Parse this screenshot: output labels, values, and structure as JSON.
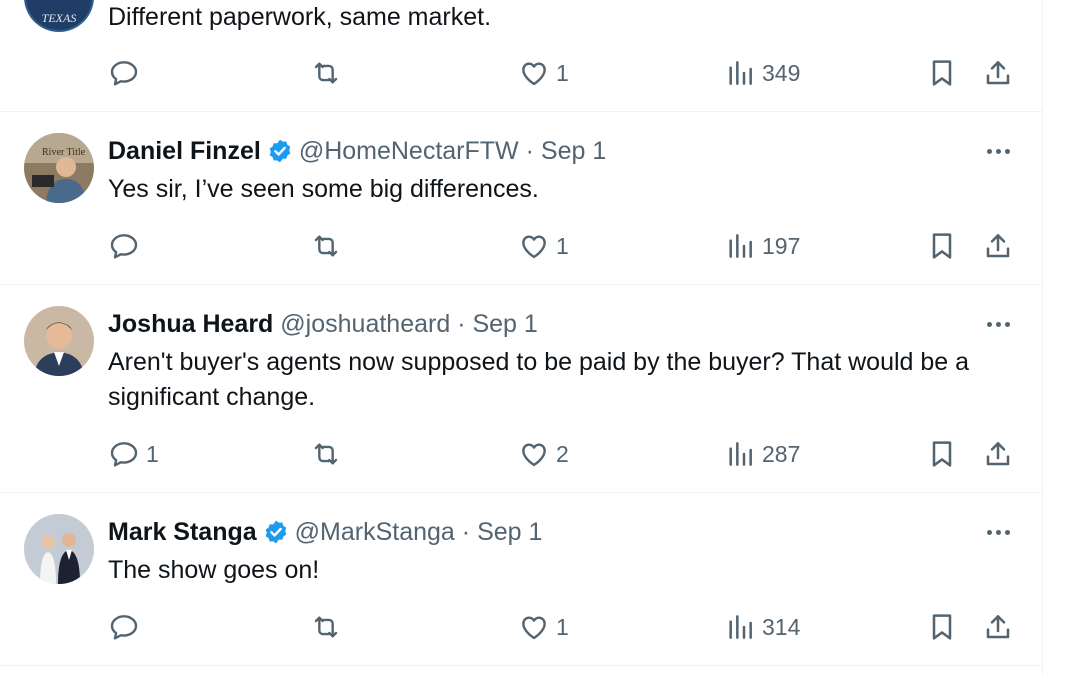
{
  "tweets": [
    {
      "avatar_badge": "TEXAS",
      "text": "Different paperwork, same market.",
      "replies": "",
      "retweets": "",
      "likes": "1",
      "views": "349"
    },
    {
      "name": "Daniel Finzel",
      "verified": true,
      "handle": "@HomeNectarFTW",
      "separator": "·",
      "date": "Sep 1",
      "text": "Yes sir, I’ve seen some big differences.",
      "replies": "",
      "retweets": "",
      "likes": "1",
      "views": "197"
    },
    {
      "name": "Joshua Heard",
      "verified": false,
      "handle": "@joshuatheard",
      "separator": "·",
      "date": "Sep 1",
      "text": "Aren't buyer's agents now supposed to be paid by the buyer? That would be a significant change.",
      "replies": "1",
      "retweets": "",
      "likes": "2",
      "views": "287"
    },
    {
      "name": "Mark Stanga",
      "verified": true,
      "handle": "@MarkStanga",
      "separator": "·",
      "date": "Sep 1",
      "text": "The show goes on!",
      "replies": "",
      "retweets": "",
      "likes": "1",
      "views": "314"
    }
  ],
  "colors": {
    "text": "#0f1419",
    "secondary": "#536471",
    "divider": "#eff3f4",
    "verified": "#1d9bf0"
  },
  "icons": [
    "reply-icon",
    "retweet-icon",
    "like-icon",
    "views-icon",
    "bookmark-icon",
    "share-icon",
    "more-icon",
    "verified-badge-icon"
  ]
}
